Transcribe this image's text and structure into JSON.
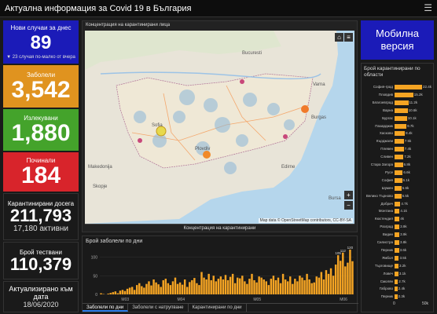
{
  "header": {
    "title": "Актуална информация за Covid 19 в България"
  },
  "cards": {
    "new": {
      "label": "Нови случаи за днес",
      "value": "89",
      "sub": "▼ 23 случая по-малко от вчера"
    },
    "infected": {
      "label": "Заболели",
      "value": "3,542"
    },
    "recovered": {
      "label": "Излекувани",
      "value": "1,880"
    },
    "dead": {
      "label": "Починали",
      "value": "184"
    },
    "quarantined": {
      "label": "Карантинирани досега",
      "value": "211,793",
      "sub": "17,180 активни"
    },
    "tested": {
      "label": "Брой тествани",
      "value": "110,379"
    },
    "updated": {
      "label": "Актуализирано към дата",
      "value": "18/06/2020"
    }
  },
  "map": {
    "title": "Концентрация на карантинирани лица",
    "attribution": "Map data © OpenStreetMap contributors, CC-BY-SA",
    "tab": "Концентрация на карантинирани",
    "home_icon": "home-icon",
    "list_icon": "list-icon",
    "labels": [
      "Bucuresti",
      "Varna",
      "Burgas",
      "Sofia",
      "Plovdiv",
      "Skopje",
      "Makedonija",
      "Edirne",
      "Bursa"
    ]
  },
  "mobile": {
    "line1": "Мобилна",
    "line2": "версия"
  },
  "regions": {
    "title": "Брой карантинирани по области",
    "items": [
      {
        "name": "София-град",
        "label": "22.4k",
        "value": 22.4
      },
      {
        "name": "Пловдив",
        "label": "15.2k",
        "value": 15.2
      },
      {
        "name": "Благоевград",
        "label": "11.2k",
        "value": 11.2
      },
      {
        "name": "Варна",
        "label": "10.6k",
        "value": 10.6
      },
      {
        "name": "Бургас",
        "label": "10.1k",
        "value": 10.1
      },
      {
        "name": "Пазарджик",
        "label": "9.7k",
        "value": 9.7
      },
      {
        "name": "Хасково",
        "label": "8.4k",
        "value": 8.4
      },
      {
        "name": "Кърджали",
        "label": "7.5k",
        "value": 7.5
      },
      {
        "name": "Плевен",
        "label": "7.4k",
        "value": 7.4
      },
      {
        "name": "Сливен",
        "label": "7.2k",
        "value": 7.2
      },
      {
        "name": "Стара Загора",
        "label": "6.8k",
        "value": 6.8
      },
      {
        "name": "Русе",
        "label": "6.6k",
        "value": 6.6
      },
      {
        "name": "София",
        "label": "6.1k",
        "value": 6.1
      },
      {
        "name": "Шумен",
        "label": "5.6k",
        "value": 5.6
      },
      {
        "name": "Велико Търново",
        "label": "5.5k",
        "value": 5.5
      },
      {
        "name": "Добрич",
        "label": "4.7k",
        "value": 4.7
      },
      {
        "name": "Монтана",
        "label": "4.1k",
        "value": 4.1
      },
      {
        "name": "Кюстендил",
        "label": "4k",
        "value": 4.0
      },
      {
        "name": "Разград",
        "label": "3.9k",
        "value": 3.9
      },
      {
        "name": "Видин",
        "label": "3.9k",
        "value": 3.9
      },
      {
        "name": "Силистра",
        "label": "3.8k",
        "value": 3.8
      },
      {
        "name": "Перник",
        "label": "3.6k",
        "value": 3.6
      },
      {
        "name": "Ямбол",
        "label": "3.5k",
        "value": 3.5
      },
      {
        "name": "Търговище",
        "label": "3.2k",
        "value": 3.2
      },
      {
        "name": "Ловеч",
        "label": "3.1k",
        "value": 3.1
      },
      {
        "name": "Смолян",
        "label": "2.7k",
        "value": 2.7
      },
      {
        "name": "Габрово",
        "label": "2.4k",
        "value": 2.4
      },
      {
        "name": "Перник ",
        "label": "2.3k",
        "value": 2.3
      }
    ],
    "axis": [
      "0",
      "50k"
    ]
  },
  "daily": {
    "title": "Брой заболели по дни",
    "tabs": [
      "Заболели по дни",
      "Заболели с натрупване",
      "Карантинирани по дни"
    ]
  },
  "chart_data": {
    "type": "bar",
    "title": "Брой заболели по дни",
    "ylim": [
      0,
      120
    ],
    "yticks": [
      "100",
      "50",
      "0"
    ],
    "xticks": [
      "M03",
      "M04",
      "M05",
      "M06"
    ],
    "peak_labels": [
      "105",
      "112",
      "120"
    ],
    "values": [
      3,
      1,
      0,
      2,
      4,
      6,
      8,
      3,
      10,
      12,
      9,
      15,
      18,
      20,
      12,
      25,
      30,
      22,
      18,
      28,
      35,
      24,
      40,
      32,
      27,
      20,
      38,
      42,
      30,
      25,
      35,
      45,
      28,
      32,
      26,
      40,
      20,
      33,
      38,
      44,
      30,
      25,
      60,
      45,
      40,
      55,
      38,
      50,
      35,
      42,
      48,
      40,
      52,
      38,
      47,
      55,
      30,
      45,
      43,
      50,
      35,
      28,
      42,
      55,
      38,
      32,
      48,
      45,
      40,
      35,
      25,
      42,
      50,
      38,
      45,
      30,
      55,
      40,
      35,
      48,
      28,
      42,
      35,
      50,
      45,
      38,
      55,
      40,
      30,
      32,
      48,
      45,
      60,
      40,
      65,
      55,
      70,
      50,
      80,
      105,
      90,
      112,
      75,
      85,
      120,
      89
    ]
  }
}
